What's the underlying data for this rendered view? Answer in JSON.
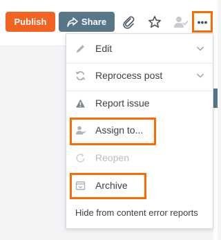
{
  "toolbar": {
    "publish_label": "Publish",
    "share_label": "Share",
    "icons": [
      "share-arrow-icon",
      "paperclip-icon",
      "star-icon",
      "assign-user-icon",
      "more-icon"
    ],
    "more_label": "•••",
    "accent_color": "#f26322",
    "share_color": "#587688",
    "highlight_color": "#ff6a00"
  },
  "menu": {
    "items": [
      {
        "label": "Edit",
        "icon": "pencil-icon",
        "has_chevron": true,
        "disabled": false
      },
      {
        "label": "Reprocess post",
        "icon": "refresh-icon",
        "has_chevron": true,
        "disabled": false
      },
      {
        "label": "Report issue",
        "icon": "warning-icon",
        "has_chevron": false,
        "disabled": false
      },
      {
        "label": "Assign to...",
        "icon": "assign-user-icon",
        "has_chevron": false,
        "disabled": false,
        "highlighted": true
      },
      {
        "label": "Reopen",
        "icon": "reopen-icon",
        "has_chevron": false,
        "disabled": true
      },
      {
        "label": "Archive",
        "icon": "archive-icon",
        "has_chevron": false,
        "disabled": false,
        "highlighted": true
      }
    ],
    "footer_label": "Hide from content error reports"
  }
}
